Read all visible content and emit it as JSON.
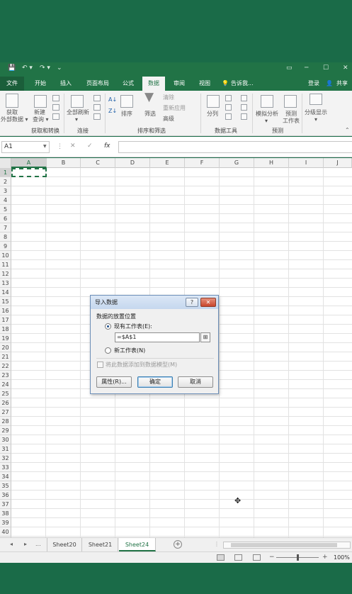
{
  "title_bar": {
    "qat": [
      "💾",
      "↶ ▾",
      "↷ ▾",
      "⌄"
    ],
    "window_controls": [
      "▭",
      "─",
      "☐",
      "✕"
    ]
  },
  "tabs": [
    "文件",
    "开始",
    "插入",
    "页面布局",
    "公式",
    "数据",
    "审阅",
    "视图",
    "告诉我..."
  ],
  "active_tab": "数据",
  "account": {
    "login": "登录",
    "share": "共享"
  },
  "ribbon": {
    "get_external": [
      "获取",
      "外部数据 ▾"
    ],
    "new_query": [
      "新建",
      "查询 ▾"
    ],
    "refresh_all": [
      "全部刷新",
      "▾"
    ],
    "sort": "排序",
    "filter": "筛选",
    "clear": "清除",
    "reapply": "重新应用",
    "advanced": "高级",
    "split": "分列",
    "what_if": [
      "模拟分析",
      "▾"
    ],
    "forecast": [
      "预测",
      "工作表"
    ],
    "outline": [
      "分级显示",
      "▾"
    ],
    "groups": [
      "获取和转换",
      "连接",
      "排序和筛选",
      "数据工具",
      "预测"
    ]
  },
  "formula_bar": {
    "name_box": "A1",
    "cancel": "✕",
    "enter": "✓",
    "fx": "fx",
    "value": ""
  },
  "columns": [
    "A",
    "B",
    "C",
    "D",
    "E",
    "F",
    "G",
    "H",
    "I",
    "J"
  ],
  "rows": [
    "1",
    "2",
    "3",
    "4",
    "5",
    "6",
    "7",
    "8",
    "9",
    "10",
    "11",
    "12",
    "13",
    "14",
    "15",
    "16",
    "17",
    "18",
    "19",
    "20",
    "21",
    "22",
    "23",
    "24",
    "25",
    "26",
    "27",
    "28",
    "29",
    "30",
    "31",
    "32",
    "33",
    "34",
    "35",
    "36",
    "37",
    "38",
    "39",
    "40",
    "41"
  ],
  "dialog": {
    "title": "导入数据",
    "help": "?",
    "close": "✕",
    "location_label": "数据的放置位置",
    "existing_sheet": "现有工作表(E):",
    "ref_value": "=$A$1",
    "ref_picker": "⊞",
    "new_sheet": "新工作表(N)",
    "add_to_model": "将此数据添加到数据模型(M)",
    "properties": "属性(R)...",
    "ok": "确定",
    "cancel": "取消",
    "selected_option": "existing"
  },
  "sheet_tabs": {
    "nav": [
      "◂",
      "▸",
      "..."
    ],
    "tabs": [
      "Sheet20",
      "Sheet21",
      "Sheet24"
    ],
    "active": "Sheet24",
    "add": "+"
  },
  "status_bar": {
    "zoom_minus": "−",
    "zoom_plus": "+",
    "zoom": "100%"
  },
  "colors": {
    "excel_green": "#217346",
    "background": "#1c6e4b"
  }
}
